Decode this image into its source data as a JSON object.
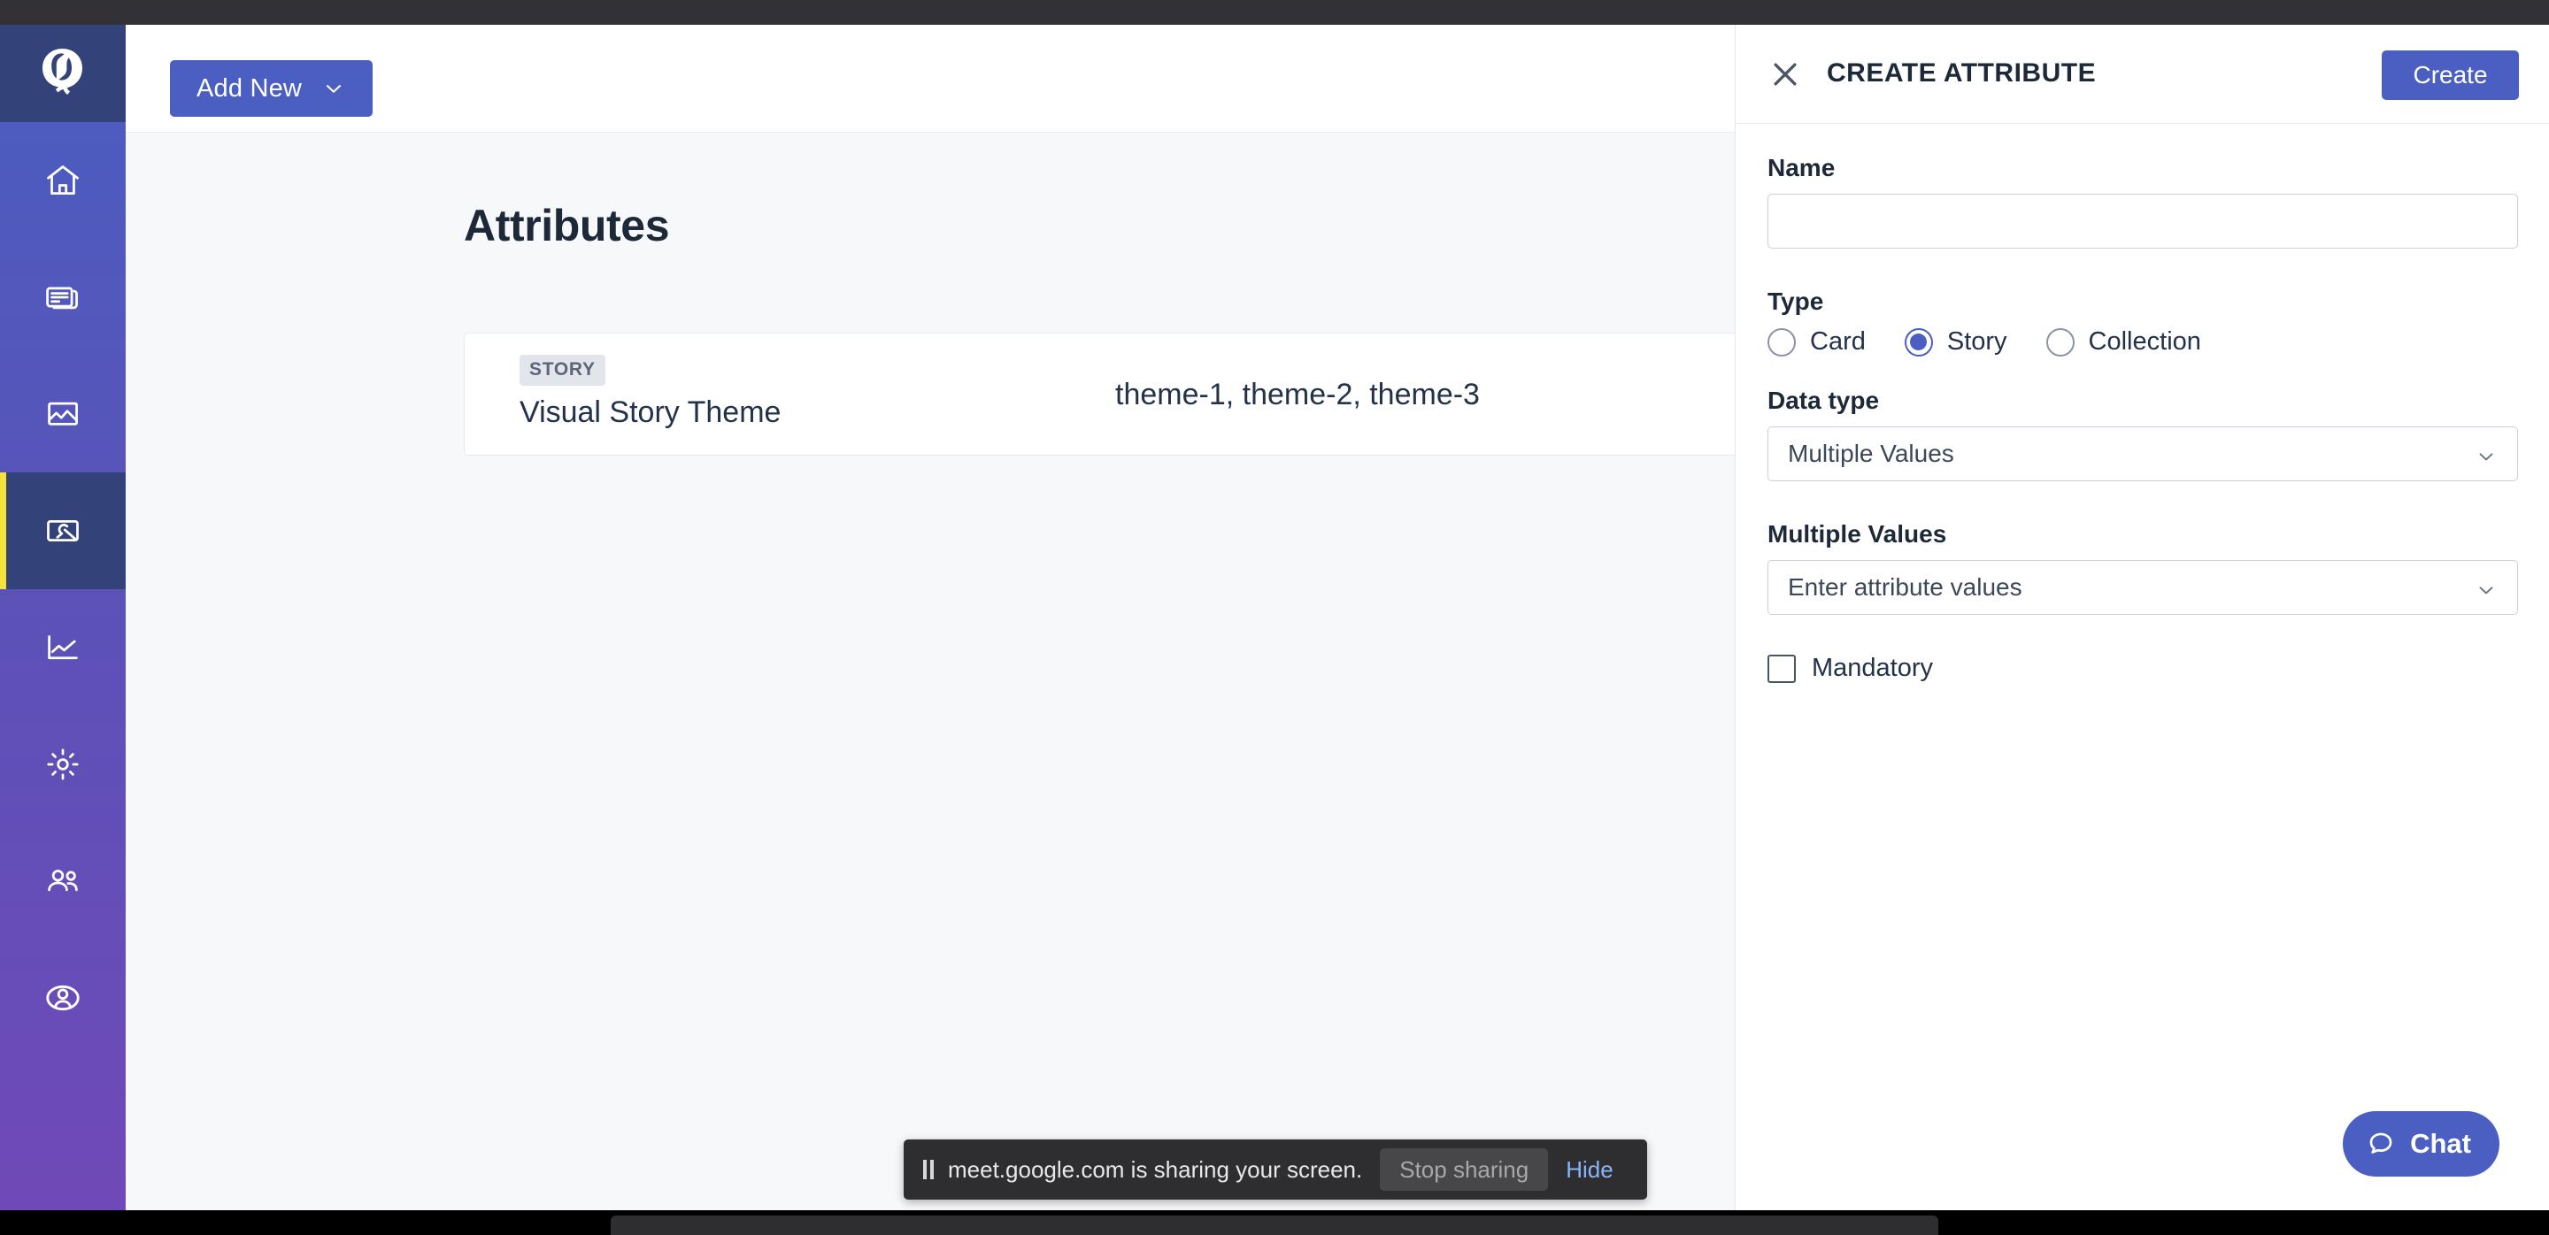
{
  "brand": {
    "logo_icon": "quintype-q-logo",
    "accent_color": "#4a5fc1",
    "rail_top_color": "#334278",
    "active_marker_color": "#f5e23d"
  },
  "sidebar": {
    "items": [
      {
        "label": "Home",
        "icon": "home-icon",
        "active": false
      },
      {
        "label": "Stories",
        "icon": "cards-icon",
        "active": false
      },
      {
        "label": "Media",
        "icon": "image-icon",
        "active": false
      },
      {
        "label": "Tools",
        "icon": "image-tools-icon",
        "active": true
      },
      {
        "label": "Analytics",
        "icon": "line-chart-icon",
        "active": false
      },
      {
        "label": "Settings",
        "icon": "gear-icon",
        "active": false
      },
      {
        "label": "Members",
        "icon": "people-icon",
        "active": false
      },
      {
        "label": "Account",
        "icon": "user-circle-icon",
        "active": false
      }
    ]
  },
  "toolbar": {
    "add_new_label": "Add New",
    "add_new_icon": "chevron-down-icon"
  },
  "main": {
    "page_title": "Attributes",
    "attributes": [
      {
        "badge": "STORY",
        "name": "Visual Story Theme",
        "values": "theme-1, theme-2, theme-3"
      }
    ]
  },
  "drawer": {
    "close_icon": "close-icon",
    "title": "CREATE ATTRIBUTE",
    "create_label": "Create",
    "name": {
      "label": "Name",
      "value": "",
      "placeholder": ""
    },
    "type": {
      "label": "Type",
      "options": [
        {
          "label": "Card",
          "selected": false
        },
        {
          "label": "Story",
          "selected": true
        },
        {
          "label": "Collection",
          "selected": false
        }
      ]
    },
    "data_type": {
      "label": "Data type",
      "value": "Multiple Values",
      "chevron_icon": "chevron-down-icon"
    },
    "multiple_values": {
      "label": "Multiple Values",
      "value": "Enter attribute values",
      "chevron_icon": "chevron-down-icon"
    },
    "mandatory": {
      "label": "Mandatory",
      "checked": false
    }
  },
  "chat": {
    "label": "Chat",
    "icon": "chat-bubble-icon"
  },
  "share_bar": {
    "pause_icon": "pause-icon",
    "message": "meet.google.com is sharing your screen.",
    "stop_label": "Stop sharing",
    "hide_label": "Hide"
  }
}
